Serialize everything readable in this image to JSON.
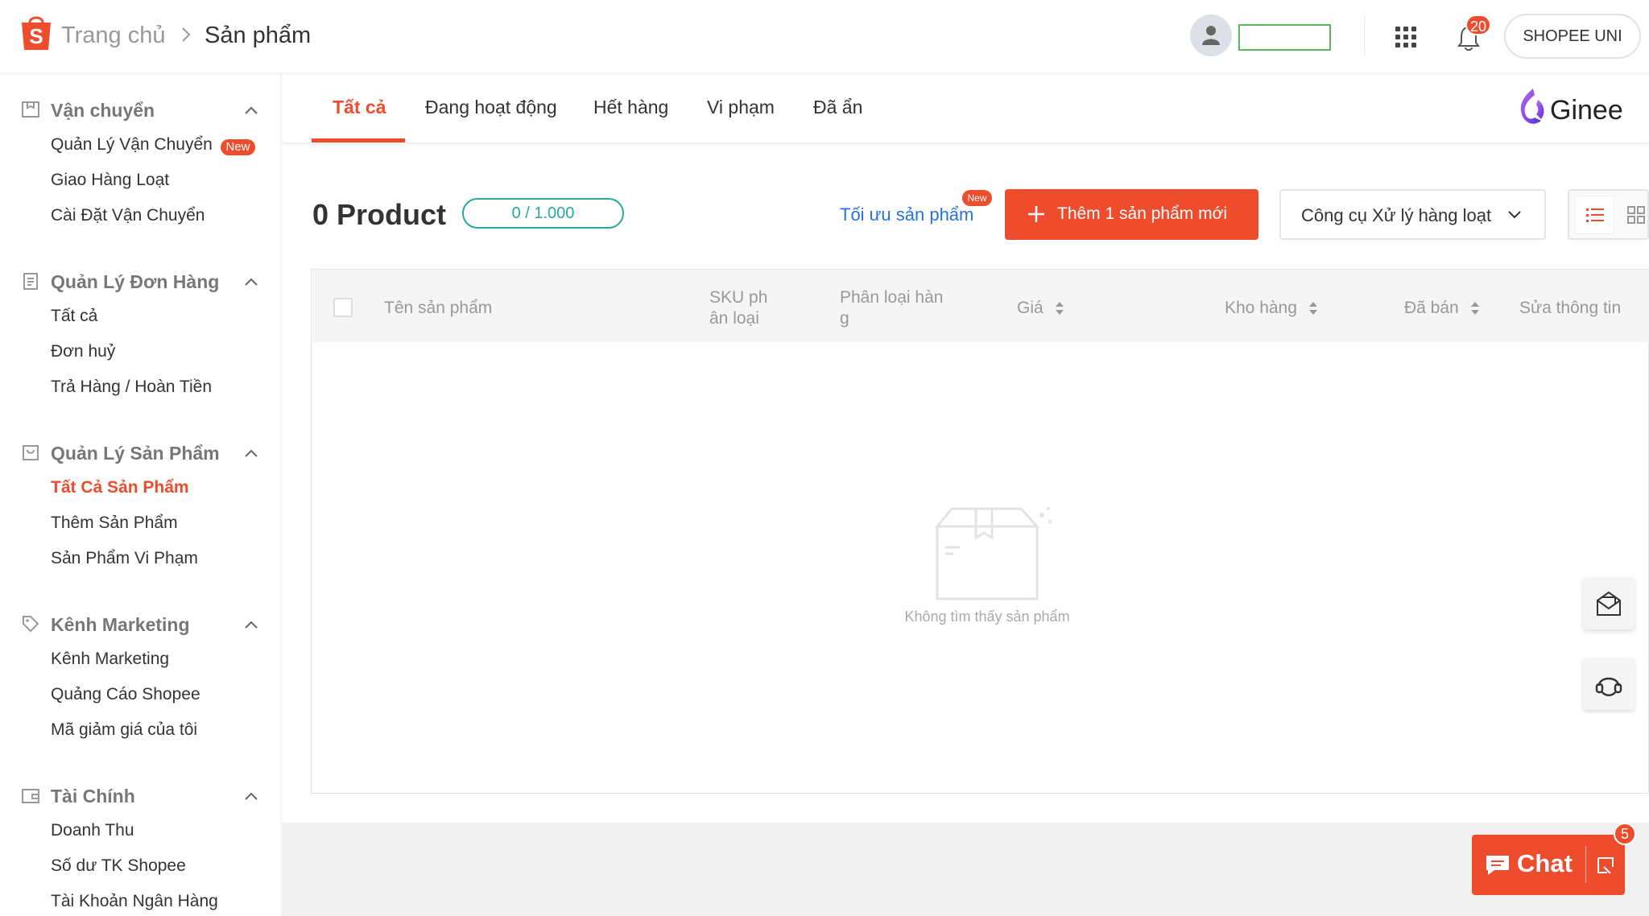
{
  "header": {
    "breadcrumb_home": "Trang chủ",
    "breadcrumb_current": "Sản phẩm",
    "notification_count": "20",
    "shop_button": "SHOPEE UNI",
    "brand_color": "#ee4d2d"
  },
  "sidebar": {
    "sections": [
      {
        "title": "Vận chuyển",
        "icon": "shipping-box-icon",
        "items": [
          {
            "label": "Quản Lý Vận Chuyển",
            "tag": "New"
          },
          {
            "label": "Giao Hàng Loạt"
          },
          {
            "label": "Cài Đặt Vận Chuyển"
          }
        ]
      },
      {
        "title": "Quản Lý Đơn Hàng",
        "icon": "clipboard-icon",
        "items": [
          {
            "label": "Tất cả"
          },
          {
            "label": "Đơn huỷ"
          },
          {
            "label": "Trả Hàng / Hoàn Tiền"
          }
        ]
      },
      {
        "title": "Quản Lý Sản Phẩm",
        "icon": "shopping-bag-icon",
        "items": [
          {
            "label": "Tất Cả Sản Phẩm",
            "active": true
          },
          {
            "label": "Thêm Sản Phẩm"
          },
          {
            "label": "Sản Phẩm Vi Phạm"
          }
        ]
      },
      {
        "title": "Kênh Marketing",
        "icon": "tag-icon",
        "items": [
          {
            "label": "Kênh Marketing"
          },
          {
            "label": "Quảng Cáo Shopee"
          },
          {
            "label": "Mã giảm giá của tôi"
          }
        ]
      },
      {
        "title": "Tài Chính",
        "icon": "wallet-icon",
        "items": [
          {
            "label": "Doanh Thu"
          },
          {
            "label": "Số dư TK Shopee"
          },
          {
            "label": "Tài Khoản Ngân Hàng"
          }
        ]
      }
    ]
  },
  "tabs": [
    {
      "label": "Tất cả",
      "active": true
    },
    {
      "label": "Đang hoạt động"
    },
    {
      "label": "Hết hàng"
    },
    {
      "label": "Vi phạm"
    },
    {
      "label": "Đã ẩn"
    }
  ],
  "ginee_logo_text": "Ginee",
  "toolbar": {
    "product_count": "0 Product",
    "quota": "0 / 1.000",
    "optimize_link": "Tối ưu sản phẩm",
    "optimize_tag": "New",
    "add_button": "Thêm 1 sản phẩm mới",
    "bulk_tools": "Công cụ Xử lý hàng loạt"
  },
  "table": {
    "columns": {
      "name": "Tên sản phẩm",
      "sku_line1": "SKU ph",
      "sku_line2": "ân loại",
      "variation_line1": "Phân loại hàn",
      "variation_line2": "g",
      "price": "Giá",
      "stock": "Kho hàng",
      "sold": "Đã bán",
      "edit": "Sửa thông tin"
    },
    "empty_text": "Không tìm thấy sản phẩm"
  },
  "chat": {
    "label": "Chat",
    "badge": "5"
  }
}
